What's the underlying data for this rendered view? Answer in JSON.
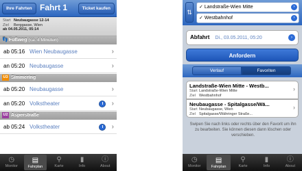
{
  "left": {
    "nav": {
      "back": "Ihre Fahrten",
      "title": "Fahrt 1",
      "right": "Ticket kaufen"
    },
    "info": {
      "start_label": "Start",
      "start_value": "Neubaugasse 12-14",
      "ziel_label": "Ziel",
      "ziel_value": "Berggasse, Wien",
      "ab_date": "ab 04.05.2011, 05:14"
    },
    "sections": {
      "walk": {
        "title": "Fußweg",
        "sub": "(ca. 4 Minuten)"
      },
      "u3": {
        "badge": "U3",
        "title": "Simmering",
        "color": "#f28c00"
      },
      "u2": {
        "badge": "U2",
        "title": "Asperstraße",
        "color": "#9b3fa0"
      }
    },
    "rows": [
      {
        "time": "ab 05:16",
        "stop": "Wien Neubaugasse"
      },
      {
        "time": "an 05:20",
        "stop": "Neubaugasse"
      },
      {
        "time": "ab 05:20",
        "stop": "Neubaugasse"
      },
      {
        "time": "an 05:20",
        "stop": "Volkstheater"
      },
      {
        "time": "ab 05:24",
        "stop": "Volkstheater"
      }
    ]
  },
  "right": {
    "from": "Landstraße-Wien Mitte",
    "to": "Westbahnhof",
    "abfahrt_label": "Abfahrt",
    "abfahrt_value": "Di., 03.05.2011, 05:20",
    "button": "Anfordern",
    "seg": [
      "Verlauf",
      "Favoriten"
    ],
    "favorites": [
      {
        "title": "Landstraße-Wien Mitte - Westb...",
        "start": "Landstraße-Wien Mitte",
        "ziel": "Westbahnhof"
      },
      {
        "title": "Neubaugasse - Spitalgasse/Wä...",
        "start": "Neubaugasse, Wien",
        "ziel": "Spitalgasse/Währinger Straße..."
      }
    ],
    "hint": "Swipen Sie nach links oder rechts über den Favorit um ihn zu bearbeiten. Sie können diesen dann löschen oder verschieben."
  },
  "tabs": [
    {
      "label": "Monitor",
      "icon": "monitor-icon"
    },
    {
      "label": "Fahrplan",
      "icon": "schedule-icon"
    },
    {
      "label": "Karte",
      "icon": "map-icon"
    },
    {
      "label": "Info",
      "icon": "info-icon"
    },
    {
      "label": "About",
      "icon": "about-icon"
    }
  ]
}
